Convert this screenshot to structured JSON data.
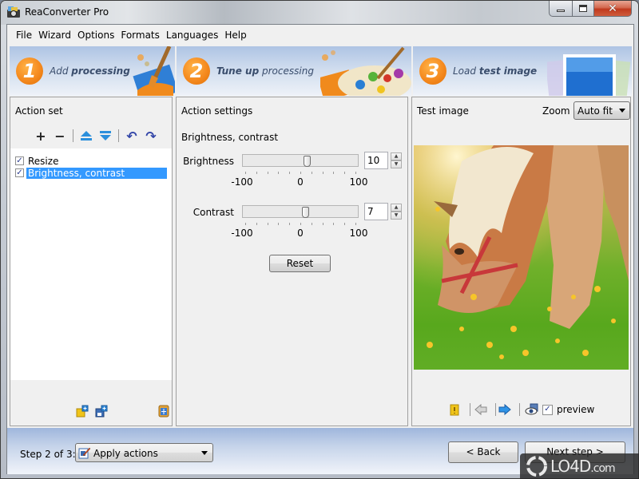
{
  "window": {
    "title": "ReaConverter Pro",
    "icon": "app-camera-icon",
    "controls": [
      "minimize",
      "maximize",
      "close"
    ]
  },
  "menu": [
    "File",
    "Wizard",
    "Options",
    "Formats",
    "Languages",
    "Help"
  ],
  "steps": [
    {
      "number": "1",
      "label_plain": "Add ",
      "label_bold": "processing",
      "bold_first": false
    },
    {
      "number": "2",
      "label_bold": "Tune up",
      "label_plain": " processing",
      "bold_first": true
    },
    {
      "number": "3",
      "label_plain": "Load ",
      "label_bold": "test image",
      "bold_first": false
    }
  ],
  "action_set": {
    "title": "Action set",
    "toolbar": [
      {
        "name": "add-action-icon",
        "glyph": "+"
      },
      {
        "name": "remove-action-icon",
        "glyph": "−"
      },
      {
        "name": "move-up-icon",
        "glyph": "⏶"
      },
      {
        "name": "move-down-icon",
        "glyph": "⏷"
      },
      {
        "name": "undo-icon",
        "glyph": "↶"
      },
      {
        "name": "redo-icon",
        "glyph": "↷"
      }
    ],
    "items": [
      {
        "label": "Resize",
        "checked": true,
        "selected": false
      },
      {
        "label": "Brightness, contrast",
        "checked": true,
        "selected": true
      }
    ],
    "bottom_icons": [
      "add-folder-icon",
      "save-set-icon",
      "calculator-icon"
    ]
  },
  "action_settings": {
    "title": "Action settings",
    "subheading": "Brightness, contrast",
    "sliders": [
      {
        "label": "Brightness",
        "value": "10",
        "min": -100,
        "max": 100,
        "min_label": "-100",
        "mid_label": "0",
        "max_label": "100"
      },
      {
        "label": "Contrast",
        "value": "7",
        "min": -100,
        "max": 100,
        "min_label": "-100",
        "mid_label": "0",
        "max_label": "100"
      }
    ],
    "reset_label": "Reset"
  },
  "test_image": {
    "title": "Test image",
    "zoom_label": "Zoom",
    "zoom_value": "Auto fit",
    "image_description": "horse grazing in a meadow",
    "preview_label": "preview",
    "preview_checked": true
  },
  "footer": {
    "step_of": "Step 2 of 3:",
    "action_select": "Apply actions",
    "back_label": "< Back",
    "next_label": "Next step >"
  },
  "watermark": {
    "text": "LO4D",
    "suffix": ".com"
  }
}
